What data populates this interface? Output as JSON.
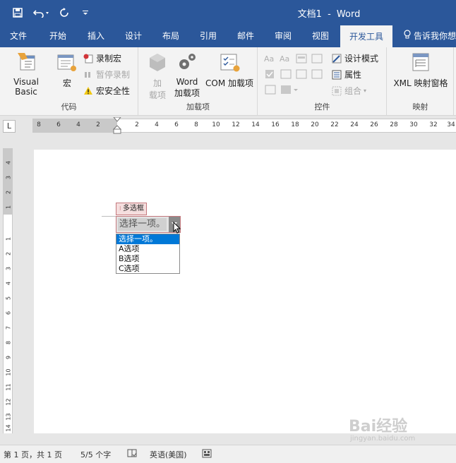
{
  "titlebar": {
    "doc_name": "文档1",
    "separator": "-",
    "app_name": "Word"
  },
  "tabs": [
    {
      "label": "文件"
    },
    {
      "label": "开始"
    },
    {
      "label": "插入"
    },
    {
      "label": "设计"
    },
    {
      "label": "布局"
    },
    {
      "label": "引用"
    },
    {
      "label": "邮件"
    },
    {
      "label": "审阅"
    },
    {
      "label": "视图"
    },
    {
      "label": "开发工具",
      "active": true
    }
  ],
  "tellme": "告诉我你想",
  "ribbon": {
    "code": {
      "label": "代码",
      "visual_basic": "Visual Basic",
      "macros": "宏",
      "record_macro": "录制宏",
      "pause_recording": "暂停录制",
      "macro_security": "宏安全性"
    },
    "addins": {
      "label": "加载项",
      "addins_line1": "加",
      "addins_line2": "载项",
      "word_addins_line1": "Word",
      "word_addins_line2": "加载项",
      "com_addins": "COM 加载项"
    },
    "controls": {
      "label": "控件",
      "design_mode": "设计模式",
      "properties": "属性",
      "group": "组合"
    },
    "mapping": {
      "label": "映射",
      "xml_pane": "XML 映射窗格"
    }
  },
  "ruler": {
    "corner": "L",
    "h_numbers": [
      "8",
      "6",
      "4",
      "2",
      "2",
      "4",
      "6",
      "8",
      "10",
      "12",
      "14",
      "16",
      "18",
      "20",
      "22",
      "24",
      "26",
      "28",
      "30",
      "32",
      "34"
    ],
    "v_numbers": [
      "4",
      "3",
      "2",
      "1",
      "1",
      "2",
      "3",
      "4",
      "5",
      "6",
      "7",
      "8",
      "9",
      "10",
      "11",
      "12",
      "13",
      "14"
    ]
  },
  "content_control": {
    "tag": "多选框",
    "placeholder": "选择一项。",
    "options": [
      "选择一项。",
      "A选项",
      "B选项",
      "C选项"
    ],
    "selected_index": 0
  },
  "statusbar": {
    "page": "第 1 页，共 1 页",
    "words": "5/5 个字",
    "language": "英语(美国)"
  },
  "watermark": {
    "text": "Bai经验",
    "url": "jingyan.baidu.com"
  },
  "colors": {
    "ribbon_blue": "#2b579a",
    "selection_blue": "#0078d7",
    "control_border": "#c4787d"
  }
}
